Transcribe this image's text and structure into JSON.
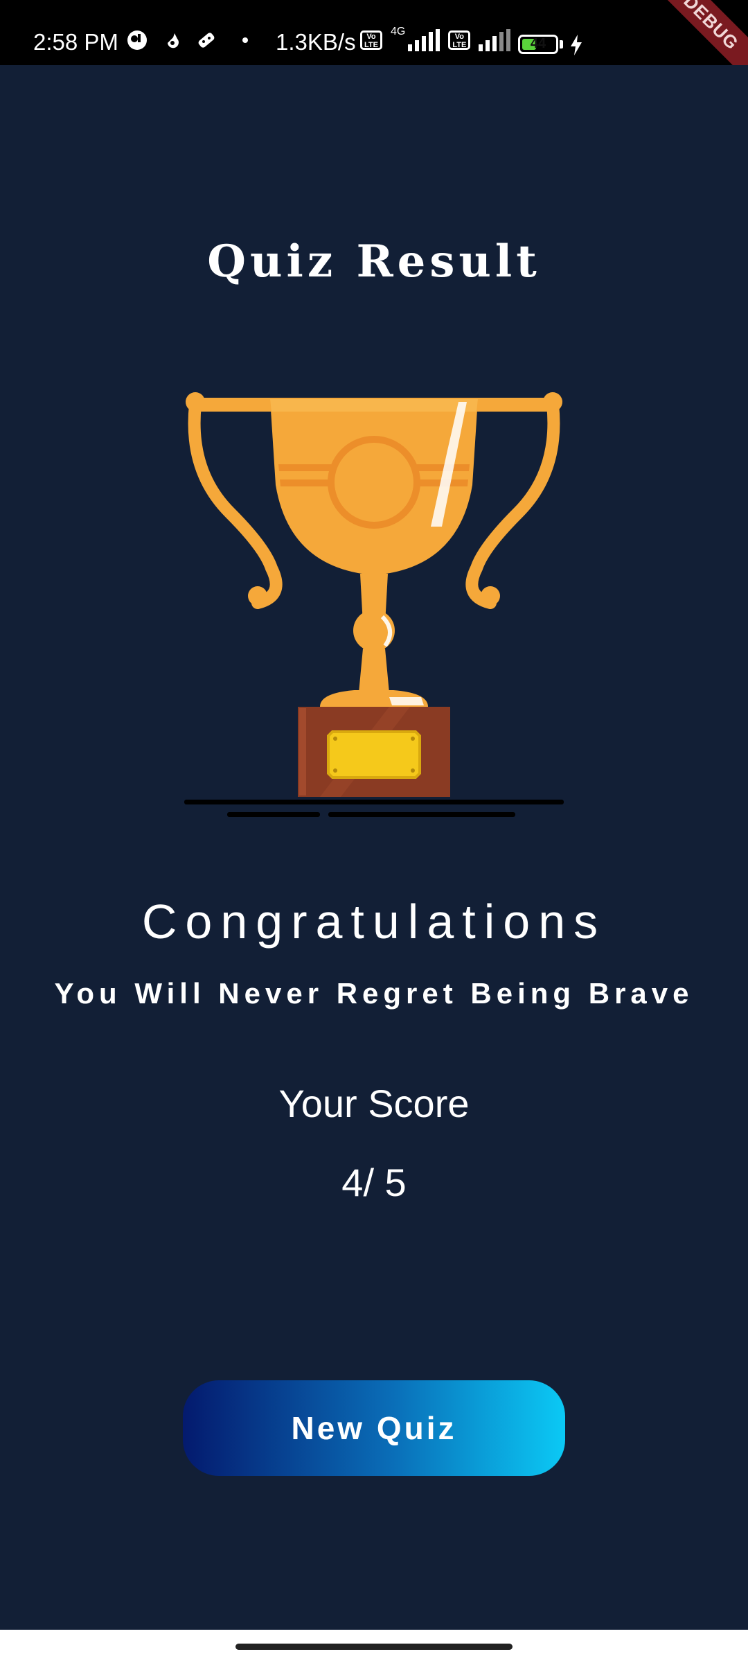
{
  "status_bar": {
    "time": "2:58 PM",
    "network_speed": "1.3KB/s",
    "network_type": "4G",
    "volte_label": "Vo LTE",
    "battery_level": "44",
    "debug_banner": "DEBUG",
    "icons": [
      "notification-icon",
      "gesture-icon",
      "game-icon",
      "wifi-signal-icon",
      "cell-signal-icon",
      "battery-icon",
      "charging-icon"
    ]
  },
  "main": {
    "title": "Quiz Result",
    "congrats": "Congratulations",
    "subtitle": "You Will Never Regret Being Brave",
    "score_label": "Your Score",
    "score_value": "4/ 5",
    "new_quiz_label": "New Quiz",
    "trophy_icon": "trophy-icon"
  },
  "colors": {
    "background": "#121f36",
    "status_bar": "#000000",
    "trophy_gold": "#f5a83a",
    "trophy_base": "#8a3b23",
    "plaque": "#f5c91b",
    "button_gradient_start": "#041a6e",
    "button_gradient_end": "#0bc9f5",
    "debug_ribbon": "#7a1a20"
  },
  "score": {
    "correct": 4,
    "total": 5
  }
}
